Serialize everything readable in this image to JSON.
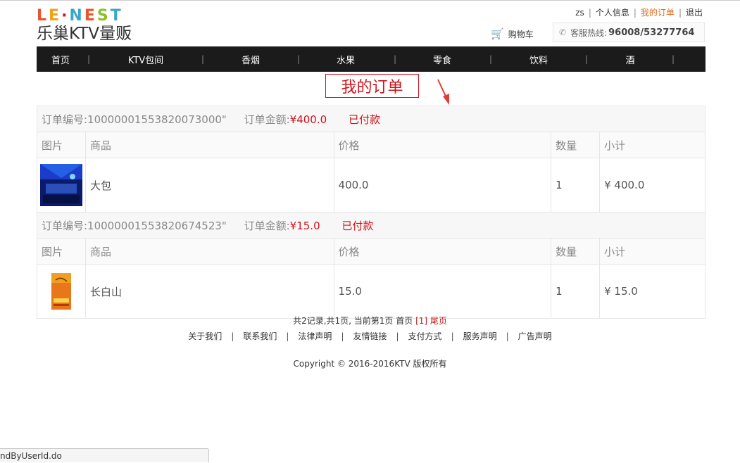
{
  "logo": {
    "top": "LE·NEST",
    "bottom": "乐巢KTV量贩"
  },
  "top_links": {
    "user": "zs",
    "profile": "个人信息",
    "orders": "我的订单",
    "logout": "退出"
  },
  "cart_label": "购物车",
  "hotline": {
    "label": "客服热线:",
    "number": "96008/53277764"
  },
  "nav": [
    "首页",
    "KTV包间",
    "香烟",
    "水果",
    "零食",
    "饮料",
    "酒"
  ],
  "page_title": "我的订单",
  "columns": {
    "image": "图片",
    "product": "商品",
    "price": "价格",
    "qty": "数量",
    "subtotal": "小计"
  },
  "orders": [
    {
      "number": "订单编号:10000001553820073000\"",
      "amount_label": "订单金额:",
      "amount": "¥400.0",
      "status": "已付款",
      "item": {
        "name": "大包",
        "price": "400.0",
        "qty": "1",
        "subtotal": "¥ 400.0"
      }
    },
    {
      "number": "订单编号:10000001553820674523\"",
      "amount_label": "订单金额:",
      "amount": "¥15.0",
      "status": "已付款",
      "item": {
        "name": "长白山",
        "price": "15.0",
        "qty": "1",
        "subtotal": "¥ 15.0"
      }
    }
  ],
  "pager": {
    "summary": "共2记录,共1页, 当前第1页 首页",
    "current": "[1]",
    "last": "尾页"
  },
  "footer_links": [
    "关于我们",
    "联系我们",
    "法律声明",
    "友情链接",
    "支付方式",
    "服务声明",
    "广告声明"
  ],
  "copyright": "Copyright © 2016-2016KTV 版权所有",
  "status_bar": "ndByUserId.do",
  "colors": {
    "accent": "#d0121b",
    "nav_bg": "#1b1b1b",
    "active_link": "#e06a1a"
  }
}
